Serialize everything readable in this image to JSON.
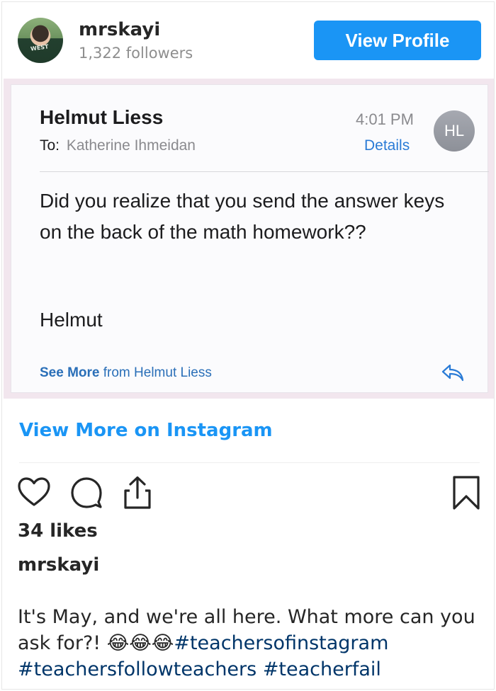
{
  "header": {
    "username": "mrskayi",
    "followers": "1,322 followers",
    "view_profile_label": "View Profile",
    "avatar_shirt_text": "WEST"
  },
  "email": {
    "sender": "Helmut Liess",
    "to_label": "To:",
    "to_name": "Katherine Ihmeidan",
    "time": "4:01 PM",
    "details_label": "Details",
    "initials": "HL",
    "body": "Did you realize that you send the answer keys on the back of the math homework??",
    "signature": "Helmut",
    "see_more_bold": "See More",
    "see_more_rest": " from Helmut Liess"
  },
  "post": {
    "view_more_label": "View More on Instagram",
    "likes": "34 likes",
    "owner": "mrskayi",
    "caption_text": "It's May, and we're all here. What more can you ask for?! 😂😂😂",
    "hashtags": [
      "#teachersofinstagram",
      "#teachersfollowteachers",
      "#teacherfail"
    ]
  },
  "icons": {
    "like": "heart-icon",
    "comment": "comment-icon",
    "share": "share-icon",
    "save": "bookmark-icon",
    "reply": "reply-icon"
  },
  "colors": {
    "accent": "#1a95f5",
    "hashtag": "#003569",
    "mail_link": "#2a7bd6"
  }
}
